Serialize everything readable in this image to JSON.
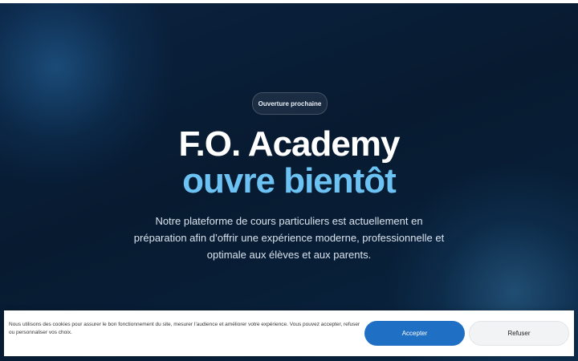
{
  "hero": {
    "badge": "Ouverture prochaine",
    "title_line1": "F.O. Academy",
    "title_line2": "ouvre bientôt",
    "description": "Notre plateforme de cours particuliers est actuellement en préparation afin d’offrir une expérience moderne, professionnelle et optimale aux élèves et aux parents."
  },
  "cookie_banner": {
    "text": "Nous utilisons des cookies pour assurer le bon fonctionnement du site, mesurer l’audience et améliorer votre expérience. Vous pouvez accepter, refuser ou personnaliser vos choix.",
    "accept_label": "Accepter",
    "refuse_label": "Refuser"
  },
  "colors": {
    "background": "#071a30",
    "accent": "#6cc3f3",
    "accept_button": "#1f6fc4"
  }
}
